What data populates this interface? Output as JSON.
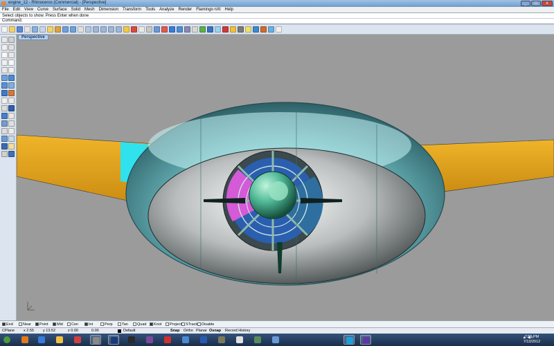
{
  "window": {
    "title": "engine_12 - Rhinoceros (Commercial) - [Perspective]",
    "minimize": "_",
    "maximize": "□",
    "close": "x"
  },
  "menu": [
    "File",
    "Edit",
    "View",
    "Curve",
    "Surface",
    "Solid",
    "Mesh",
    "Dimension",
    "Transform",
    "Tools",
    "Analyze",
    "Render",
    "Flamingo nXt",
    "Help"
  ],
  "command_history": "Select objects to show. Press Enter when done",
  "command_prompt": "Command:",
  "viewport": {
    "tab_label": "Perspective"
  },
  "osnaps": [
    {
      "label": "End",
      "checked": true
    },
    {
      "label": "Near",
      "checked": false
    },
    {
      "label": "Point",
      "checked": true
    },
    {
      "label": "Mid",
      "checked": true
    },
    {
      "label": "Cen",
      "checked": false
    },
    {
      "label": "Int",
      "checked": true
    },
    {
      "label": "Perp",
      "checked": false
    },
    {
      "label": "Tan",
      "checked": false
    },
    {
      "label": "Quad",
      "checked": false
    },
    {
      "label": "Knot",
      "checked": true
    },
    {
      "label": "Project",
      "checked": false
    },
    {
      "label": "STrack",
      "checked": false
    },
    {
      "label": "Disable",
      "checked": false
    }
  ],
  "status": {
    "cplane": "CPlane",
    "x": "x 2.55",
    "y": "y 13.52",
    "z": "z 0.00",
    "value": "0.00",
    "layer": "Default",
    "snap": "Snap",
    "ortho": "Ortho",
    "planar": "Planar",
    "osnap": "Osnap",
    "record_history": "Record History"
  },
  "clock": {
    "time": "7:55 PM",
    "date": "7/13/2012"
  },
  "colors": {
    "viewport_bg": "#9b9b9b",
    "wing": "#e2a21a",
    "nacelle": "#7fd0d4",
    "spinner": "#4fb896",
    "accent_magenta": "#d45ad8",
    "accent_blue": "#3a5fd8"
  },
  "icons": {
    "toolbar": [
      "new-icon",
      "open-icon",
      "save-icon",
      "print-icon",
      "import-icon",
      "cut-icon",
      "copy-icon",
      "paste-icon",
      "undo-icon",
      "redo-icon",
      "pan-icon",
      "rotate-view-icon",
      "zoom-icon",
      "zoom-window-icon",
      "zoom-extents-icon",
      "zoom-selected-icon",
      "zoom-target-icon",
      "named-views-icon",
      "4-views-icon",
      "grid-icon",
      "cplane-icon",
      "layer-icon",
      "properties-icon",
      "object-snap-icon",
      "point-icon",
      "render-icon",
      "material-icon",
      "shade-icon",
      "ghosted-icon",
      "environment-icon",
      "sun-icon",
      "camera-icon",
      "light-icon",
      "render-window-icon",
      "flamingo-icon",
      "options-icon",
      "help-icon"
    ],
    "taskbar": [
      "start-icon",
      "firefox-icon",
      "explorer-icon",
      "folder-icon",
      "media-player-icon",
      "rhino-icon",
      "photoshop-icon",
      "inkscape-icon",
      "app-icon",
      "pdf-icon",
      "paint-icon",
      "word-icon",
      "gimp-icon",
      "search-icon",
      "calc-icon",
      "chart-icon",
      "skype-icon",
      "eye-icon"
    ]
  }
}
